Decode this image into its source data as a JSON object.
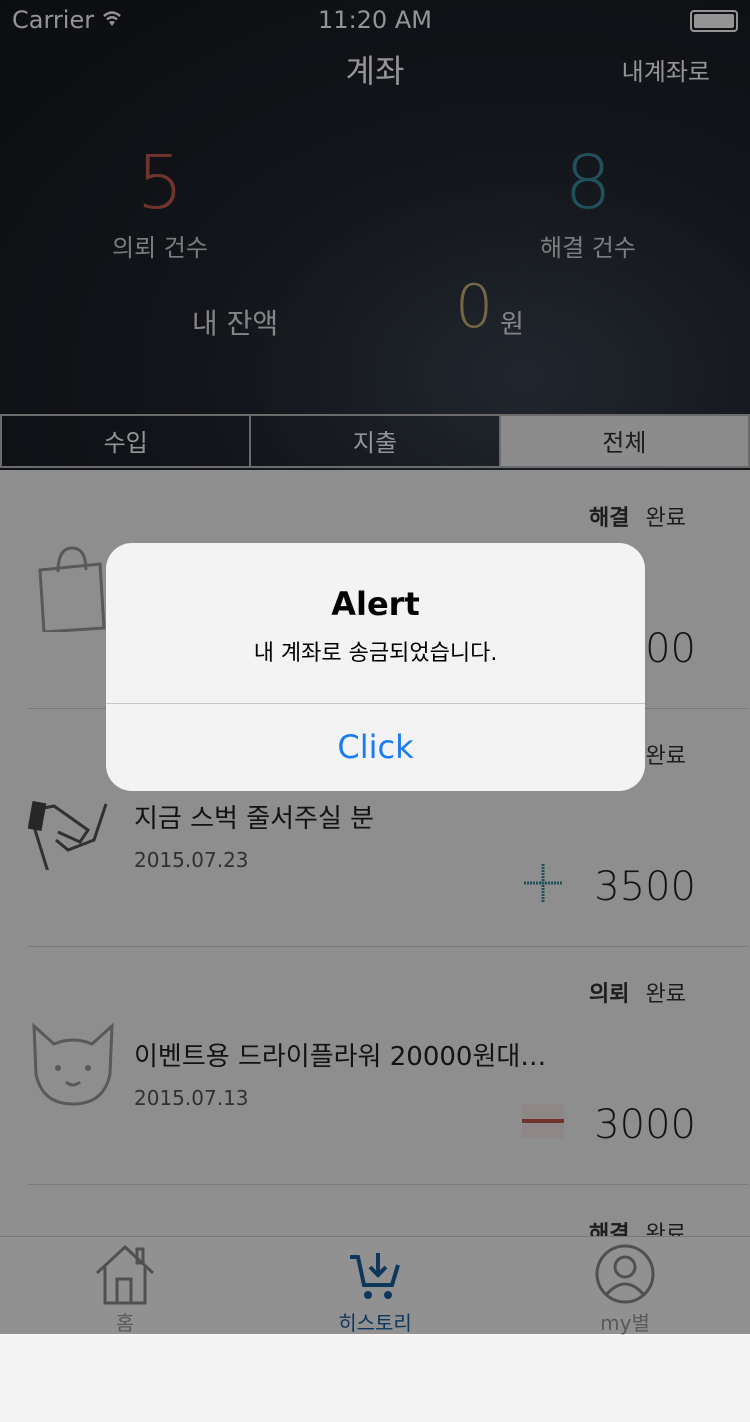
{
  "status_bar": {
    "carrier": "Carrier",
    "time": "11:20 AM"
  },
  "header": {
    "title": "계좌",
    "my_account_button": "내계좌로"
  },
  "stats": {
    "requests_count": "5",
    "requests_label": "의뢰 건수",
    "solved_count": "8",
    "solved_label": "해결 건수",
    "balance_label": "내 잔액",
    "balance_value": "0",
    "balance_unit": "원"
  },
  "tabs": [
    {
      "label": "수입",
      "active": false
    },
    {
      "label": "지출",
      "active": false
    },
    {
      "label": "전체",
      "active": true
    }
  ],
  "list": [
    {
      "status_type": "해결",
      "status_state": "완료",
      "title": "",
      "date": "",
      "amount": "00",
      "icon": "shopping-bag-icon",
      "sign": ""
    },
    {
      "status_type": "",
      "status_state": "완료",
      "title": "지금 스벅 줄서주실 분",
      "date": "2015.07.23",
      "amount": "3500",
      "icon": "handshake-icon",
      "sign": "plus"
    },
    {
      "status_type": "의뢰",
      "status_state": "완료",
      "title": "이벤트용 드라이플라워 20000원대…",
      "date": "2015.07.13",
      "amount": "3000",
      "icon": "cat-face-icon",
      "sign": "minus"
    },
    {
      "status_type": "해결",
      "status_state": "완료",
      "title": "",
      "date": "",
      "amount": "",
      "icon": "",
      "sign": ""
    }
  ],
  "tab_bar": [
    {
      "label": "홈",
      "icon": "home-icon"
    },
    {
      "label": "히스토리",
      "icon": "cart-icon"
    },
    {
      "label": "my별",
      "icon": "profile-icon"
    }
  ],
  "alert": {
    "title": "Alert",
    "message": "내 계좌로 송금되었습니다.",
    "button": "Click"
  },
  "colors": {
    "request": "#c25a4c",
    "solved": "#3a8aa0",
    "balance": "#c8b278",
    "link": "#1a7cf5",
    "tab_active": "#1a5fa0"
  }
}
